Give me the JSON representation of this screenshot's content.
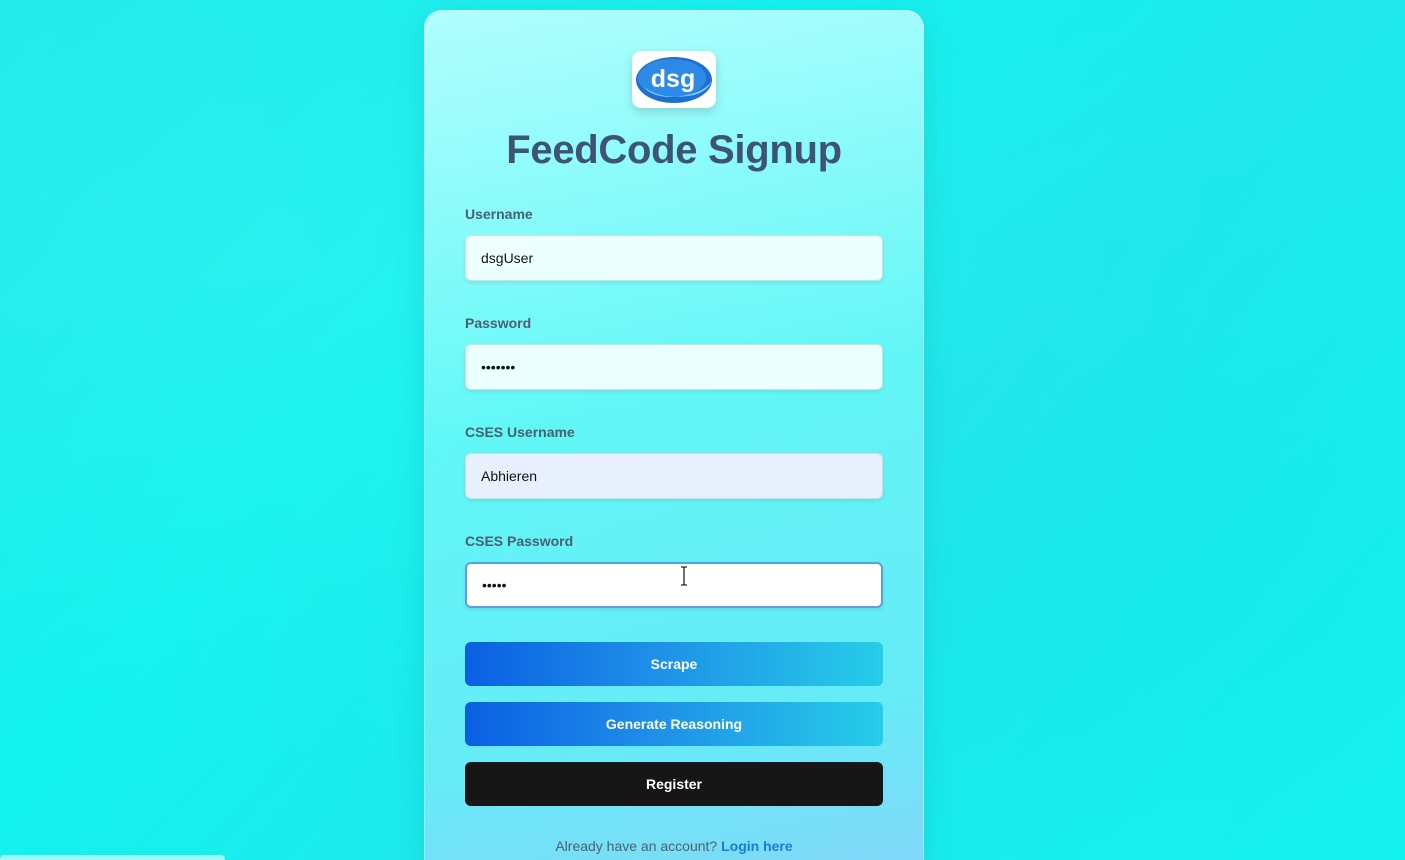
{
  "app": {
    "title": "FeedCode Signup",
    "logo_text": "dsg"
  },
  "form": {
    "username": {
      "label": "Username",
      "value": "dsgUser"
    },
    "password": {
      "label": "Password",
      "value": "•••••••"
    },
    "cses_username": {
      "label": "CSES Username",
      "value": "Abhieren"
    },
    "cses_password": {
      "label": "CSES Password",
      "value": "•••••"
    }
  },
  "buttons": {
    "scrape": "Scrape",
    "generate_reasoning": "Generate Reasoning",
    "register": "Register"
  },
  "footer": {
    "prompt": "Already have an account?",
    "link": "Login here"
  },
  "colors": {
    "background": "#1de9ea",
    "title": "#3e5476",
    "primary_gradient_start": "#0a5fe3",
    "primary_gradient_end": "#26cde9",
    "register_button": "#161616",
    "link": "#1a7fd0"
  },
  "icons": {
    "cursor": "text-cursor-icon"
  }
}
